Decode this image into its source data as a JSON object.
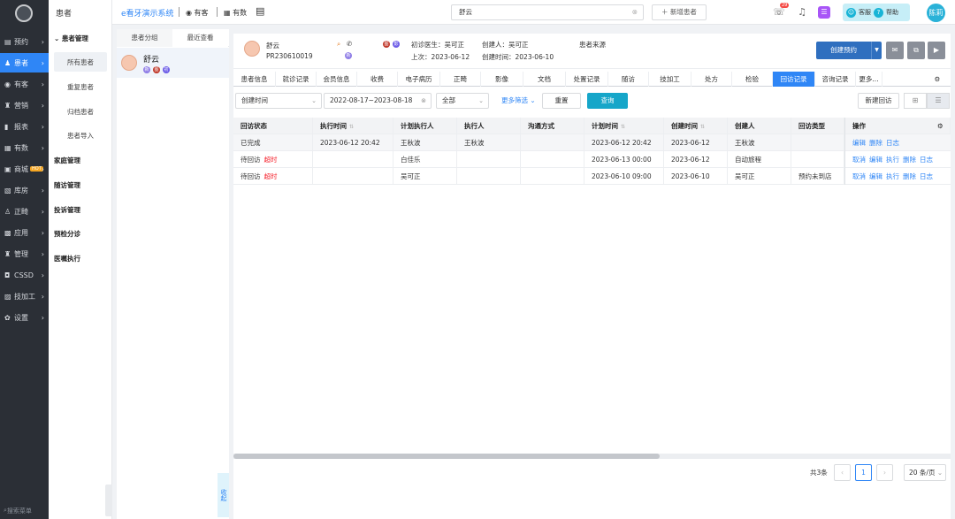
{
  "nav": {
    "items": [
      {
        "label": "预约",
        "icon": "calendar-icon"
      },
      {
        "label": "患者",
        "icon": "user-icon"
      },
      {
        "label": "有客",
        "icon": "eye-icon"
      },
      {
        "label": "营销",
        "icon": "megaphone-icon"
      },
      {
        "label": "报表",
        "icon": "bar-chart-icon"
      },
      {
        "label": "有数",
        "icon": "chart-icon"
      },
      {
        "label": "商城",
        "icon": "cart-icon",
        "badge": "HOT"
      },
      {
        "label": "库房",
        "icon": "warehouse-icon"
      },
      {
        "label": "正畸",
        "icon": "tooth-icon"
      },
      {
        "label": "应用",
        "icon": "apps-icon"
      },
      {
        "label": "管理",
        "icon": "settings-icon"
      },
      {
        "label": "CSSD",
        "icon": "sterilize-icon"
      },
      {
        "label": "技加工",
        "icon": "tool-icon"
      },
      {
        "label": "设置",
        "icon": "gear-icon"
      }
    ],
    "search_label": "搜索菜单"
  },
  "submenu": {
    "header": "患者",
    "group_title": "患者管理",
    "items": [
      "所有患者",
      "重复患者",
      "归档患者",
      "患者导入"
    ],
    "groups": [
      "家庭管理",
      "随访管理",
      "投诉管理",
      "预检分诊",
      "医嘱执行"
    ]
  },
  "topbar": {
    "brand": "e看牙演示系统",
    "links": [
      "有客",
      "有数"
    ],
    "search_value": "舒云",
    "new_patient": "新增患者",
    "msg_badge": "29",
    "service": "客服",
    "help": "帮助",
    "user": "陈莉"
  },
  "patient_list": {
    "tabs": [
      "患者分组",
      "最近查看"
    ],
    "patient_name": "舒云",
    "tags": [
      "新",
      "图",
      "初"
    ]
  },
  "patient_header": {
    "name": "舒云",
    "id": "PR230610019",
    "first_doctor": "初诊医生：吴可正",
    "creator": "创建人：吴可正",
    "source": "患者来源",
    "last_visit": "上次：2023-06-12",
    "created": "创建时间：2023-06-10",
    "create_appointment": "创建预约",
    "tag_new": "新",
    "mini_tags": [
      "图",
      "影"
    ]
  },
  "tabs": [
    "患者信息",
    "就诊记录",
    "会员信息",
    "收费",
    "电子病历",
    "正畸",
    "影像",
    "文档",
    "处置记录",
    "随访",
    "技加工",
    "处方",
    "检验",
    "回访记录",
    "咨询记录",
    "更多..."
  ],
  "active_tab": "回访记录",
  "filters": {
    "time_field": "创建时间",
    "date_range": "2022-08-17~2023-08-18",
    "status": "全部",
    "more_filters": "更多筛选",
    "reset": "重置",
    "query": "查询",
    "new_followup": "新建回访"
  },
  "table": {
    "headers": [
      "回访状态",
      "执行时间",
      "计划执行人",
      "执行人",
      "沟通方式",
      "计划时间",
      "创建时间",
      "创建人",
      "回访类型",
      "操作"
    ],
    "rows": [
      {
        "status": "已完成",
        "overdue": "",
        "exec_time": "2023-06-12 20:42",
        "planner": "王秋波",
        "executor": "王秋波",
        "method": "",
        "plan_time": "2023-06-12 20:42",
        "created": "2023-06-12",
        "creator": "王秋波",
        "type": "",
        "actions": [
          "编辑",
          "删除",
          "日志"
        ]
      },
      {
        "status": "待回访",
        "overdue": "超时",
        "exec_time": "",
        "planner": "白佳乐",
        "executor": "",
        "method": "",
        "plan_time": "2023-06-13 00:00",
        "created": "2023-06-12",
        "creator": "自动旅程",
        "type": "",
        "actions": [
          "取消",
          "编辑",
          "执行",
          "删除",
          "日志"
        ]
      },
      {
        "status": "待回访",
        "overdue": "超时",
        "exec_time": "",
        "planner": "吴可正",
        "executor": "",
        "method": "",
        "plan_time": "2023-06-10 09:00",
        "created": "2023-06-10",
        "creator": "吴可正",
        "type": "预约未到店",
        "actions": [
          "取消",
          "编辑",
          "执行",
          "删除",
          "日志"
        ]
      }
    ]
  },
  "pagination": {
    "total": "共3条",
    "page": "1",
    "page_size": "20 条/页"
  },
  "collapse_label": "收起"
}
